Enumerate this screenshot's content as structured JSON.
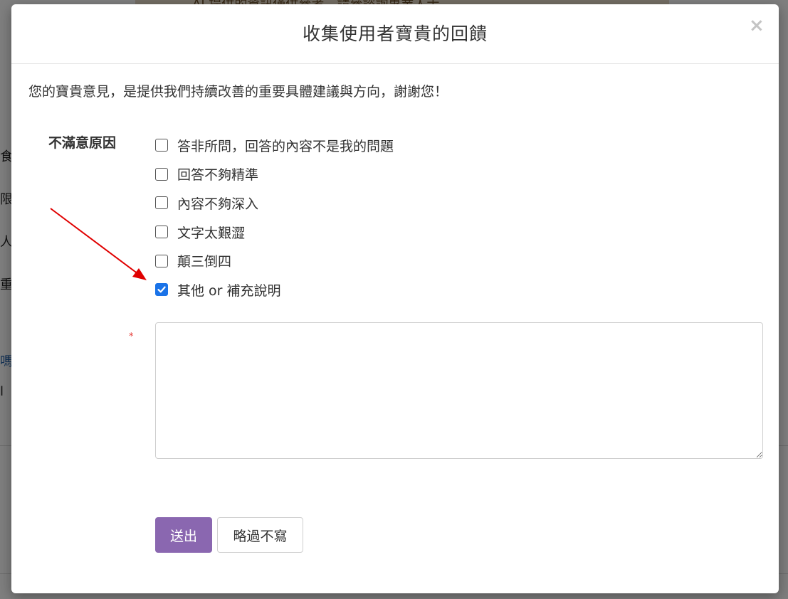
{
  "background": {
    "banner_text": "AI 提供的資訊僅供參考，請參諮詢專業人士",
    "side_glyphs": [
      "食",
      "限",
      "人",
      "重",
      "嗎",
      "l"
    ]
  },
  "modal": {
    "title": "收集使用者寶貴的回饋",
    "close_label": "×",
    "intro": "您的寶貴意見，是提供我們持續改善的重要具體建議與方向，謝謝您！",
    "field_label": "不滿意原因",
    "options": [
      {
        "label": "答非所問，回答的內容不是我的問題",
        "checked": false
      },
      {
        "label": "回答不夠精準",
        "checked": false
      },
      {
        "label": "內容不夠深入",
        "checked": false
      },
      {
        "label": "文字太艱澀",
        "checked": false
      },
      {
        "label": "顛三倒四",
        "checked": false
      },
      {
        "label": "其他 or 補充說明",
        "checked": true
      }
    ],
    "required_marker": "*",
    "textarea_value": "",
    "submit_label": "送出",
    "skip_label": "略過不寫"
  },
  "colors": {
    "submit_bg": "#8a67b0",
    "checkbox_checked": "#1a73e8",
    "required": "#e53935",
    "annotation_arrow": "#e00000"
  }
}
